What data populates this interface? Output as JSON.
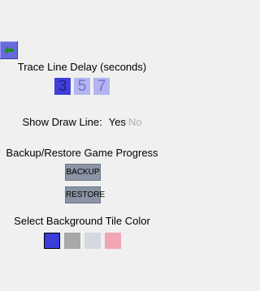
{
  "back_button": {
    "icon": "arrow-left-icon",
    "background": "#6a6adf",
    "arrow_color": "#1f8f1f"
  },
  "trace_delay": {
    "label": "Trace Line Delay (seconds)",
    "options": [
      "3",
      "5",
      "7"
    ],
    "selected": "3"
  },
  "draw_line": {
    "label": "Show Draw Line:",
    "yes_label": "Yes",
    "no_label": "No",
    "selected": "Yes"
  },
  "backup_restore": {
    "label": "Backup/Restore Game Progress",
    "backup_label": "BACKUP",
    "restore_label": "RESTORE"
  },
  "tile_color": {
    "label": "Select Background Tile Color",
    "colors": [
      "#3c3cd8",
      "#a8a8a8",
      "#d6d8e0",
      "#f0a6b4"
    ],
    "selected_index": 0
  }
}
